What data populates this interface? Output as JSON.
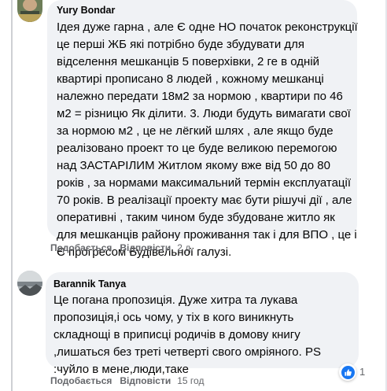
{
  "comments": [
    {
      "author": "Yury Bondar",
      "lines": [
        "Ідея дуже гарна , але Є одне НО початок реконструкції",
        "це перші ЖБ які потрібно буде збудувати для",
        "відселення мешканців 5 поверхівки, 2 ге в одній",
        "квартирі прописано 8 людей , кожному мешканці",
        "належно передати 18м2 за нормою , квартири по 46",
        "м2 = різницю Як ділити. 3. Люди будуть вимагати свої",
        "за нормою м2 , це не лёгкий шлях , але якщо буде",
        "реалізовано проект то це буде великою перемогою",
        "над ЗАСТАРІЛИМ Житлом якому вже від 50 до 80",
        "років , за нормами максимальний термін експлуатації",
        "70 років. В реалізації проекту має бути рішучі дії , але",
        "оперативні , таким чином буде збудоване житло як",
        "для мешканців району проживання так і для ВПО , це і",
        "Є прогресом Будівельної галузі."
      ],
      "like_label": "Подобається",
      "reply_label": "Відповісти",
      "time": "2 д."
    },
    {
      "author": "Barannik Tanya",
      "lines": [
        "Це погана пропозиція. Дуже хитра та лукава",
        "пропозиція,і ось чому, у тіх в кого виникнуть",
        "складнощі в приписці родичів в домову книгу",
        ",лишаться без треті четверті свого омріяного. PS",
        ":чуйло в мене,люди,таке"
      ],
      "like_label": "Подобається",
      "reply_label": "Відповісти",
      "time": "15 год",
      "reaction_count": "1",
      "reaction_icon": "like-thumb-icon"
    }
  ],
  "colors": {
    "bubble": "#f0f2f5",
    "meta_text": "#65676b",
    "like_blue": "#1877f2"
  }
}
